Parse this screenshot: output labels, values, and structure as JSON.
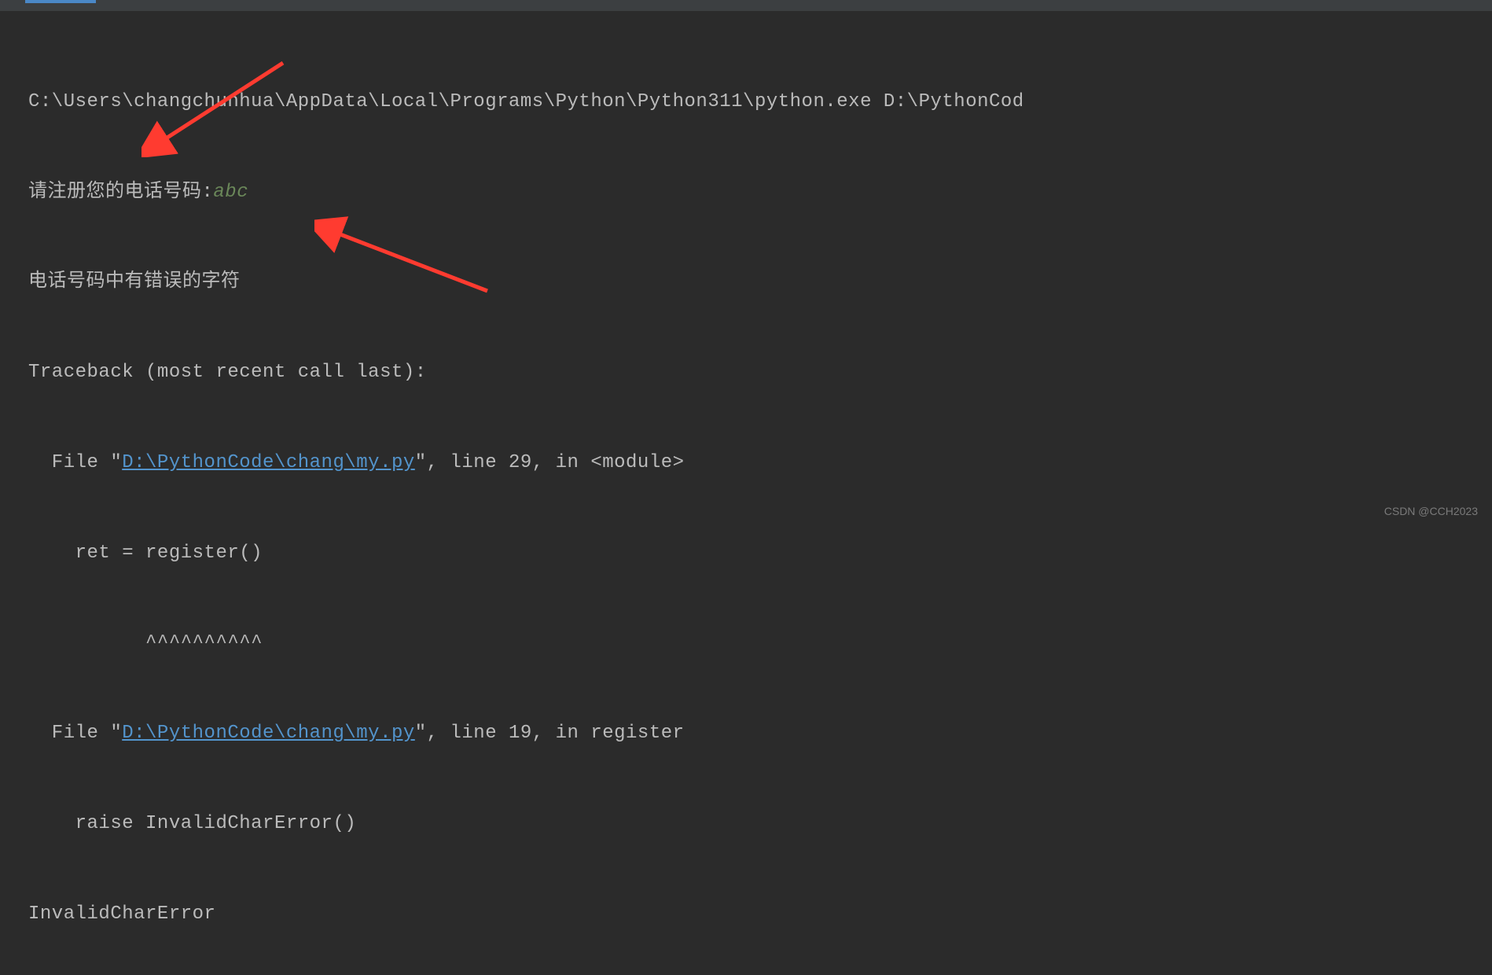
{
  "tab": {
    "active": true
  },
  "output": {
    "command": "C:\\Users\\changchunhua\\AppData\\Local\\Programs\\Python\\Python311\\python.exe D:\\PythonCod",
    "prompt": "请注册您的电话号码:",
    "userInput": "abc",
    "errorMessage": "电话号码中有错误的字符",
    "tracebackHeader": "Traceback (most recent call last):",
    "frame1": {
      "filePrefix": "  File \"",
      "fileLink": "D:\\PythonCode\\chang\\my.py",
      "fileSuffix": "\", line 29, in <module>",
      "codeLine": "    ret = register()",
      "caretLine": "          ^^^^^^^^^^"
    },
    "frame2": {
      "filePrefix": "  File \"",
      "fileLink": "D:\\PythonCode\\chang\\my.py",
      "fileSuffix": "\", line 19, in register",
      "codeLine": "    raise InvalidCharError()"
    },
    "exceptionName": "InvalidCharError"
  },
  "watermark": "CSDN @CCH2023"
}
